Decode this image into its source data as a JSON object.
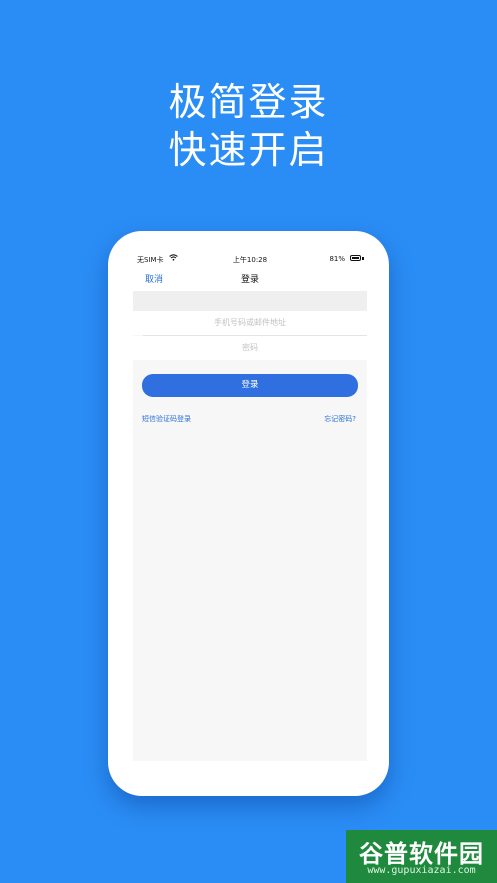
{
  "headline": {
    "line1": "极简登录",
    "line2": "快速开启"
  },
  "statusbar": {
    "carrier": "无SIM卡",
    "time": "上午10:28",
    "battery": "81%"
  },
  "navbar": {
    "cancel": "取消",
    "title": "登录"
  },
  "form": {
    "username_placeholder": "手机号码或邮件地址",
    "password_placeholder": "密码",
    "login_button": "登录",
    "sms_login": "短信验证码登录",
    "forgot_password": "忘记密码?"
  },
  "watermark": {
    "name": "谷普软件园",
    "url": "www.gupuxiazai.com"
  },
  "colors": {
    "background": "#2a8df5",
    "button": "#2f6fe0",
    "link": "#2a6fd6",
    "watermark": "#1f8a3d"
  }
}
